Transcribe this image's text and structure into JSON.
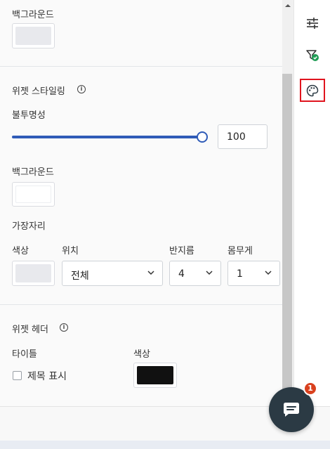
{
  "panel": {
    "background_label_top": "백그라운드",
    "widget_styling": {
      "title": "위젯 스타일링",
      "opacity_label": "불투명성",
      "opacity_value": "100",
      "opacity_fraction": 1.0,
      "background_label": "백그라운드",
      "border_label": "가장자리",
      "color_label": "색상",
      "position_label": "위치",
      "position_value": "전체",
      "radius_label": "반지름",
      "radius_value": "4",
      "thickness_label": "몸무게",
      "thickness_value": "1"
    },
    "widget_header": {
      "title": "위젯 헤더",
      "title_label": "타이틀",
      "show_title_label": "제목 표시",
      "color_label": "색상"
    }
  },
  "colors": {
    "accent": "#2f5bb7",
    "swatch_light": "#e8e9ed",
    "swatch_white": "#ffffff",
    "swatch_black": "#111111",
    "highlight": "#e0141e",
    "chat_button": "#2b3a44",
    "badge": "#d9411e"
  },
  "sidebar_icons": [
    "sliders-icon",
    "filter-check-icon",
    "palette-icon"
  ],
  "chat": {
    "badge_count": "1"
  }
}
